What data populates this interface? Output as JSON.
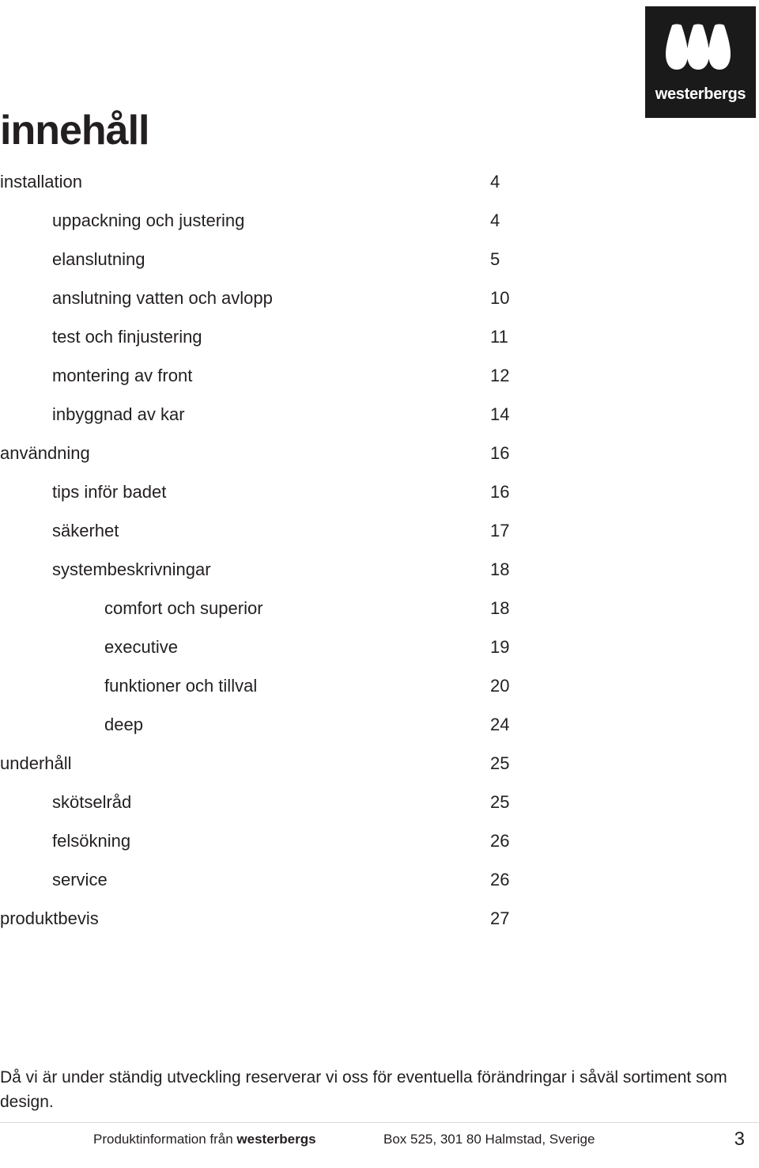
{
  "logo": {
    "icon": "westerbergs-drops-icon",
    "wordmark": "westerbergs"
  },
  "title": "innehåll",
  "toc": {
    "items": [
      {
        "label": "installation",
        "page": "4",
        "level": 0
      },
      {
        "label": "uppackning och justering",
        "page": "4",
        "level": 1
      },
      {
        "label": "elanslutning",
        "page": "5",
        "level": 1
      },
      {
        "label": "anslutning vatten och avlopp",
        "page": "10",
        "level": 1
      },
      {
        "label": "test och finjustering",
        "page": "11",
        "level": 1
      },
      {
        "label": "montering av front",
        "page": "12",
        "level": 1
      },
      {
        "label": "inbyggnad av kar",
        "page": "14",
        "level": 1
      },
      {
        "label": "användning",
        "page": "16",
        "level": 0
      },
      {
        "label": "tips inför badet",
        "page": "16",
        "level": 1
      },
      {
        "label": "säkerhet",
        "page": "17",
        "level": 1
      },
      {
        "label": "systembeskrivningar",
        "page": "18",
        "level": 1
      },
      {
        "label": "comfort och superior",
        "page": "18",
        "level": 2
      },
      {
        "label": "executive",
        "page": "19",
        "level": 2
      },
      {
        "label": "funktioner och tillval",
        "page": "20",
        "level": 2
      },
      {
        "label": "deep",
        "page": "24",
        "level": 2
      },
      {
        "label": "underhåll",
        "page": "25",
        "level": 0
      },
      {
        "label": "skötselråd",
        "page": "25",
        "level": 1
      },
      {
        "label": "felsökning",
        "page": "26",
        "level": 1
      },
      {
        "label": "service",
        "page": "26",
        "level": 1
      },
      {
        "label": "produktbevis",
        "page": "27",
        "level": 0
      }
    ]
  },
  "disclaimer": "Då vi är under ständig utveckling reserverar vi oss för eventuella förändringar i såväl sortiment som design.",
  "footer": {
    "left_prefix": "Produktinformation från ",
    "left_brand": "westerbergs",
    "middle": "Box 525, 301 80 Halmstad, Sverige",
    "page_number": "3"
  },
  "colors": {
    "ink": "#231f20",
    "logo_background": "#1a1a1a",
    "rule": "#d9d9d9"
  }
}
